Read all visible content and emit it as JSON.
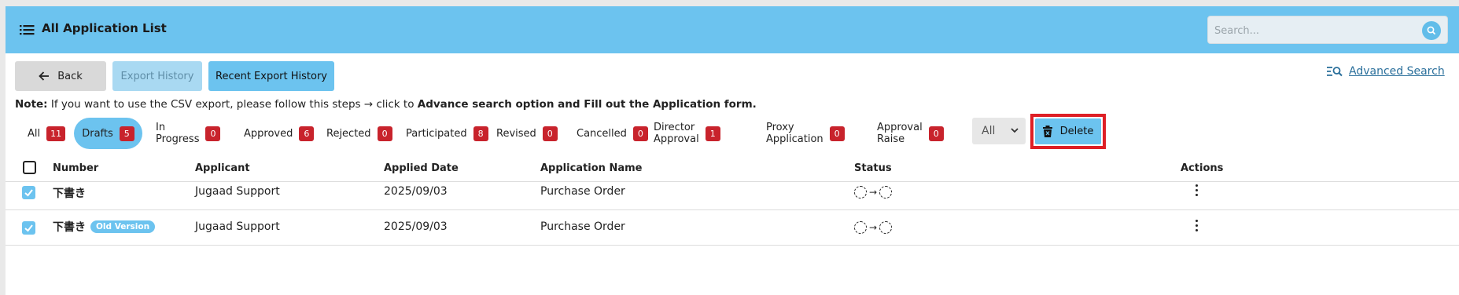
{
  "header": {
    "title": "All Application List",
    "menu_icon": "list-icon",
    "search_placeholder": "Search..."
  },
  "toolbar": {
    "back_label": "Back",
    "export_history_label": "Export History",
    "recent_export_label": "Recent Export History",
    "advanced_search_label": "Advanced Search"
  },
  "note": {
    "label": "Note:",
    "text": " If you want to use the CSV export, please follow this steps → click to ",
    "bold": "Advance search option and Fill out the Application form."
  },
  "tabs": [
    {
      "label": "All",
      "count": "11"
    },
    {
      "label": "Drafts",
      "count": "5"
    },
    {
      "label": "In Progress",
      "count": "0"
    },
    {
      "label": "Approved",
      "count": "6"
    },
    {
      "label": "Rejected",
      "count": "0"
    },
    {
      "label": "Participated",
      "count": "8"
    },
    {
      "label": "Revised",
      "count": "0"
    },
    {
      "label": "Cancelled",
      "count": "0"
    },
    {
      "label": "Director Approval",
      "count": "1"
    },
    {
      "label": "Proxy Application",
      "count": "0"
    },
    {
      "label": "Approval Raise",
      "count": "0"
    }
  ],
  "filter_select": {
    "value": "All"
  },
  "delete_label": "Delete",
  "table": {
    "columns": {
      "number": "Number",
      "applicant": "Applicant",
      "applied_date": "Applied Date",
      "application_name": "Application Name",
      "status": "Status",
      "actions": "Actions"
    },
    "rows": [
      {
        "number": "下書き",
        "badge": "",
        "applicant": "Jugaad Support",
        "applied_date": "2025/09/03",
        "application_name": "Purchase Order"
      },
      {
        "number": "下書き",
        "badge": "Old Version",
        "applicant": "Jugaad Support",
        "applied_date": "2025/09/03",
        "application_name": "Purchase Order"
      }
    ]
  },
  "colors": {
    "header_bg": "#6cc3ef",
    "badge_red": "#c8232c",
    "highlight_red": "#de1f26"
  }
}
